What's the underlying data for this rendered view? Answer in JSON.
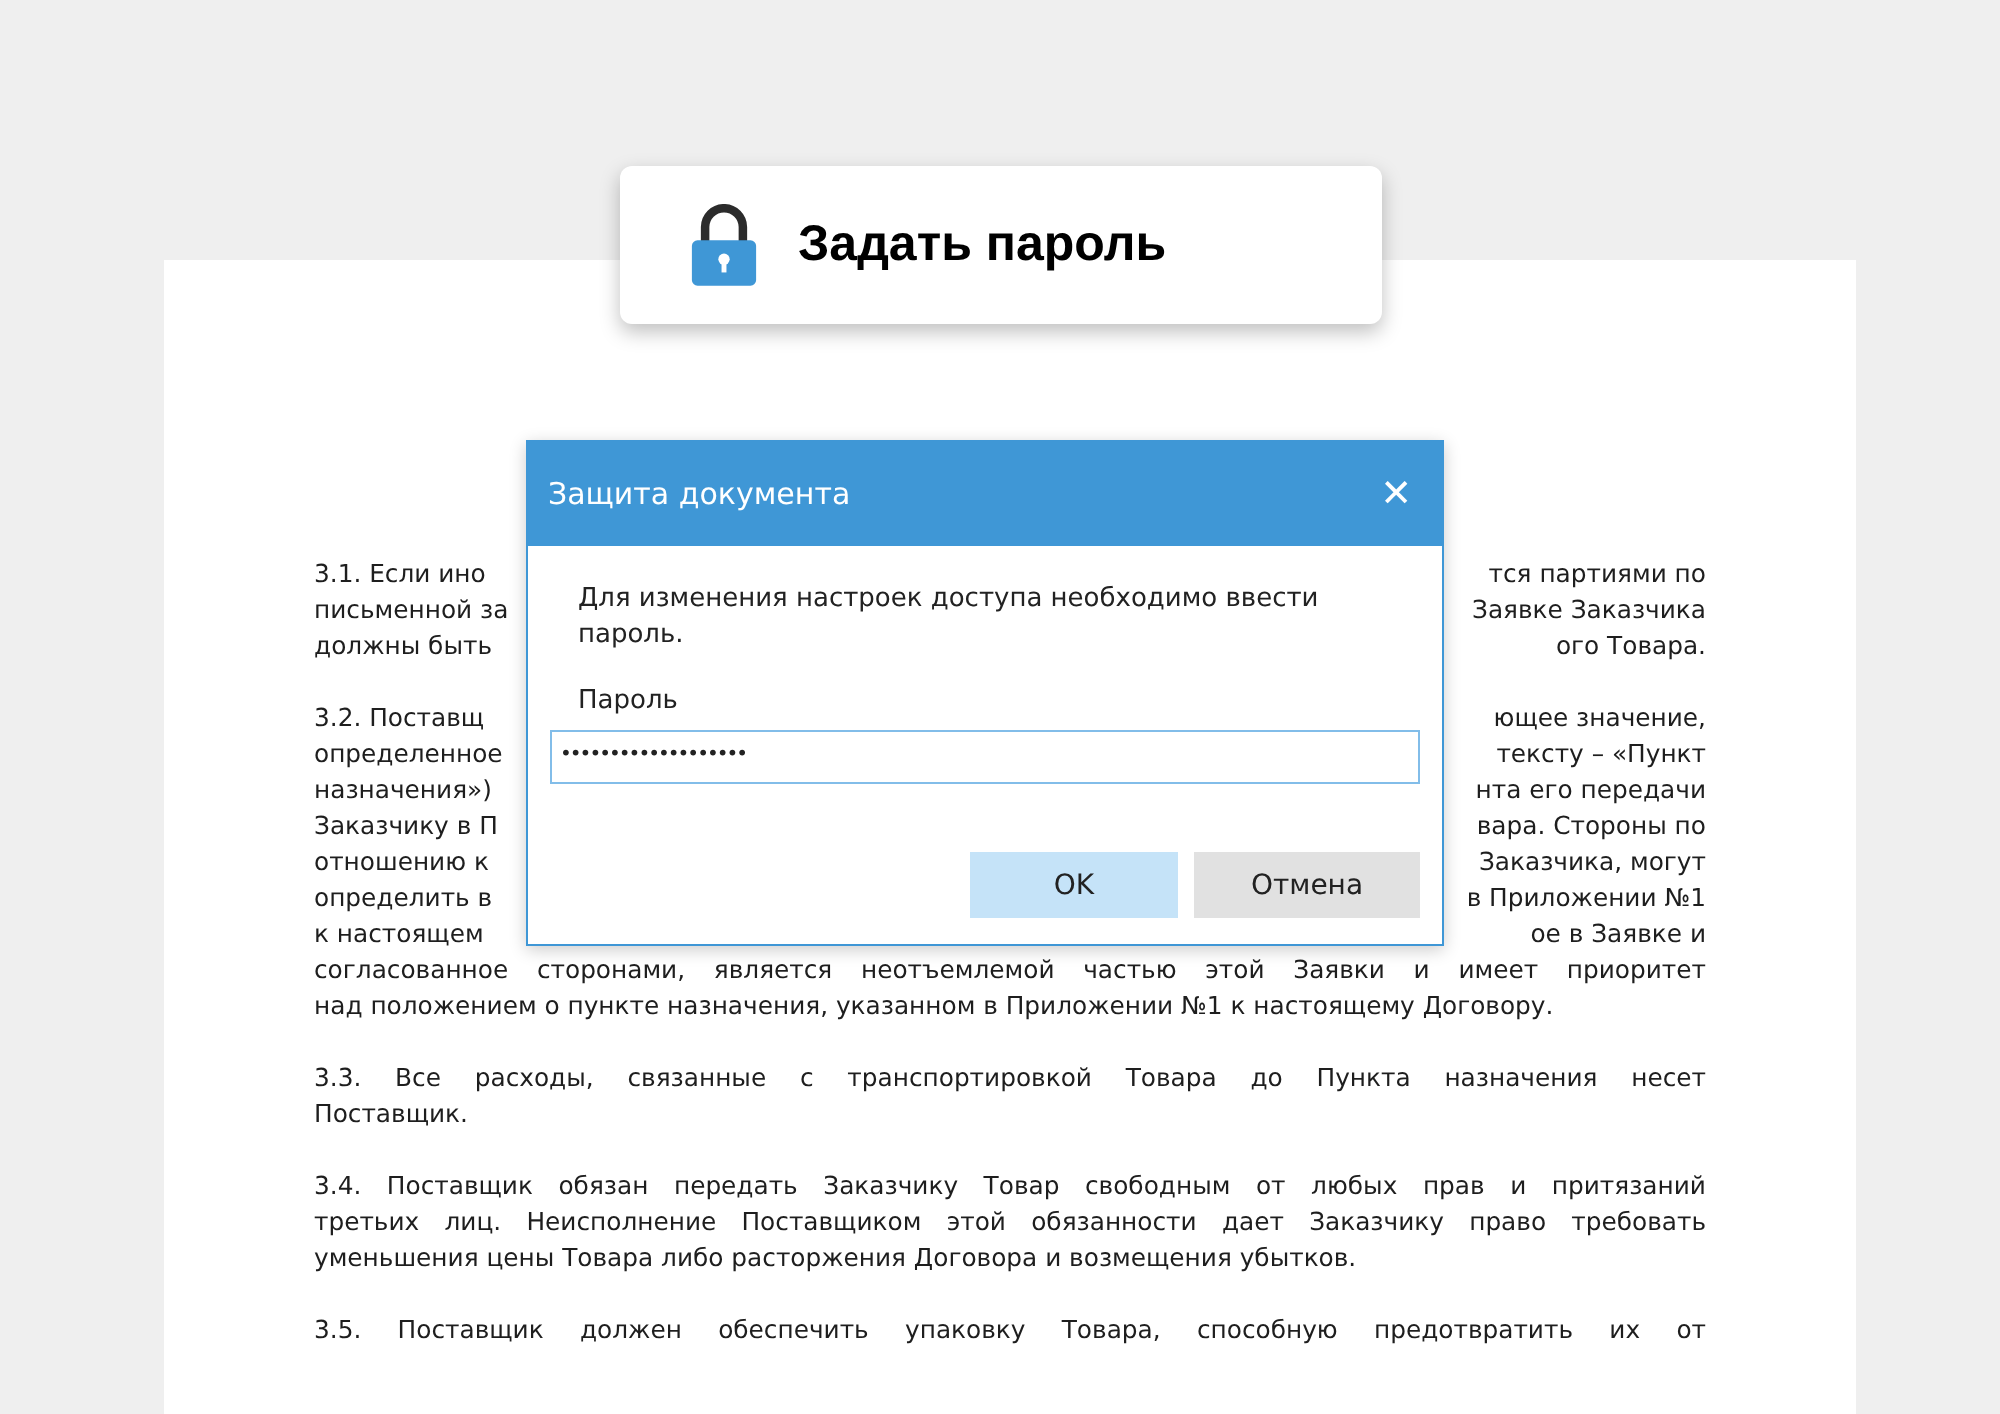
{
  "badge": {
    "title": "Задать пароль"
  },
  "document": {
    "paragraphs": [
      {
        "lines": [
          {
            "left": "3.1. Если ино",
            "right": "тся партиями по"
          },
          {
            "left": "письменной за",
            "right": "Заявке Заказчика"
          },
          {
            "left": "должны быть",
            "right": "ого Товара."
          }
        ]
      },
      {
        "lines": [
          {
            "left": "3.2. Поставщ",
            "right": "ющее значение,"
          },
          {
            "left": "определенное",
            "right": "тексту – «Пункт"
          },
          {
            "left": "назначения»)",
            "right": "нта его передачи"
          },
          {
            "left": "Заказчику в П",
            "right": "вара. Стороны по"
          },
          {
            "left": "отношению к",
            "right": "Заказчика, могут"
          },
          {
            "left": "определить в",
            "right": "в Приложении №1"
          },
          {
            "left": "к настоящем",
            "right": "ое в Заявке и"
          },
          {
            "text": "согласованное сторонами, является неотъемлемой частью этой Заявки и имеет приоритет"
          },
          {
            "text": "над положением о пункте назначения, указанном в Приложении №1 к настоящему Договору."
          }
        ]
      },
      {
        "lines": [
          {
            "text": "3.3. Все расходы, связанные с транспортировкой Товара до Пункта назначения несет"
          },
          {
            "text": "Поставщик."
          }
        ]
      },
      {
        "lines": [
          {
            "text": "3.4. Поставщик обязан передать Заказчику Товар свободным от любых прав и притязаний"
          },
          {
            "text": "третьих лиц. Неисполнение Поставщиком этой обязанности дает Заказчику право требовать"
          },
          {
            "text": "уменьшения цены Товара либо расторжения Договора и возмещения убытков."
          }
        ]
      },
      {
        "continues": true,
        "lines": [
          {
            "text": "3.5. Поставщик должен обеспечить упаковку Товара, способную предотвратить их от"
          }
        ]
      }
    ]
  },
  "dialog": {
    "title": "Защита документа",
    "close": "✕",
    "message": "Для изменения настроек доступа необходимо ввести пароль.",
    "field_label": "Пароль",
    "value": "•••••••••••••••••••",
    "buttons": [
      {
        "label": "OK",
        "kind": "primary"
      },
      {
        "label": "Отмена",
        "kind": "secondary"
      }
    ]
  }
}
